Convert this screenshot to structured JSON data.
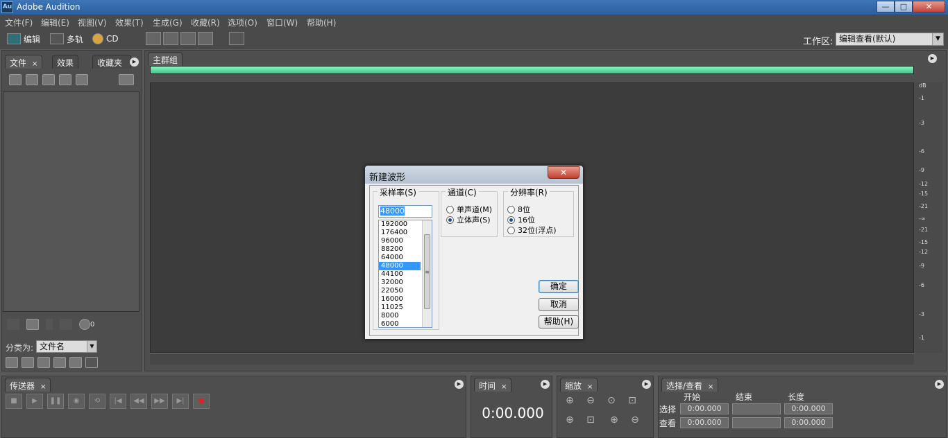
{
  "titlebar": {
    "icon": "Au",
    "title": "Adobe Audition",
    "min": "—",
    "max": "□",
    "close": "✕"
  },
  "menu": [
    "文件(F)",
    "编辑(E)",
    "视图(V)",
    "效果(T)",
    "生成(G)",
    "收藏(R)",
    "选项(O)",
    "窗口(W)",
    "帮助(H)"
  ],
  "toolbar": {
    "edit_label": "编辑",
    "multitrack_label": "多轨",
    "cd_label": "CD",
    "workspace_label": "工作区:",
    "workspace_value": "编辑查看(默认)"
  },
  "left_panel": {
    "tabs": [
      "文件",
      "效果",
      "收藏夹"
    ],
    "close": "×",
    "volume_value": "0",
    "sort_label": "分类为:",
    "sort_value": "文件名"
  },
  "main_group": {
    "tab": "主群组",
    "progress": 1.0
  },
  "ruler_ticks": [
    "dB",
    "-1",
    "-3",
    "-6",
    "-9",
    "-12",
    "-15",
    "-21",
    "-∞",
    "-21",
    "-15",
    "-12",
    "-9",
    "-6",
    "-3",
    "-1"
  ],
  "bottom": {
    "transport_tab": "传送器",
    "time_tab": "时间",
    "time_value": "0:00.000",
    "zoom_tab": "缩放",
    "selection_tab": "选择/查看",
    "col_start": "开始",
    "col_end": "结束",
    "col_length": "长度",
    "row_select": "选择",
    "row_view": "查看",
    "select_start": "0:00.000",
    "select_end": "",
    "select_length": "0:00.000",
    "view_start": "0:00.000",
    "view_end": "",
    "view_length": "0:00.000"
  },
  "dialog": {
    "title": "新建波形",
    "close": "✕",
    "sample_rate_legend": "采样率(S)",
    "sample_rate_value": "48000",
    "sample_rates": [
      "192000",
      "176400",
      "96000",
      "88200",
      "64000",
      "48000",
      "44100",
      "32000",
      "22050",
      "16000",
      "11025",
      "8000",
      "6000"
    ],
    "selected_rate_index": 5,
    "channels_legend": "通道(C)",
    "mono": "单声道(M)",
    "stereo": "立体声(S)",
    "resolution_legend": "分辨率(R)",
    "bit8": "8位",
    "bit16": "16位",
    "bit32": "32位(浮点)",
    "ok": "确定",
    "cancel": "取消",
    "help": "帮助(H)",
    "scroll_grip": "≡"
  }
}
